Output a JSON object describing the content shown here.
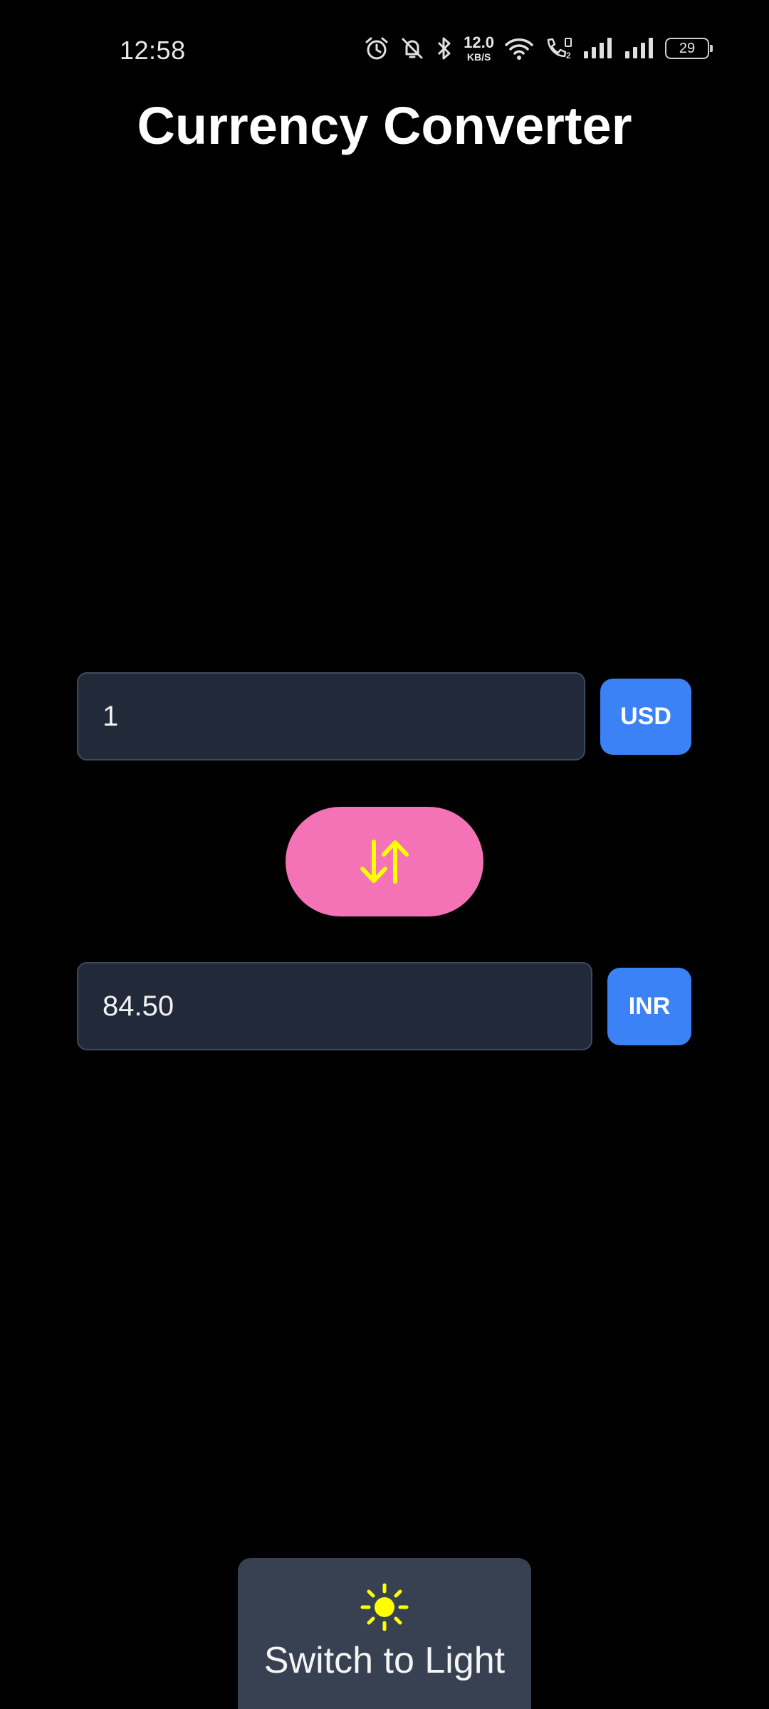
{
  "status_bar": {
    "time": "12:58",
    "net_speed_value": "12.0",
    "net_speed_unit": "KB/S",
    "battery": "29",
    "icons": [
      "alarm-icon",
      "bell-muted-icon",
      "bluetooth-icon",
      "wifi-icon",
      "volte-call-icon",
      "signal-1-icon",
      "signal-2-icon",
      "battery-icon"
    ]
  },
  "app": {
    "title": "Currency Converter"
  },
  "converter": {
    "from_amount": "1",
    "from_currency": "USD",
    "to_amount": "84.50",
    "to_currency": "INR",
    "swap_icon": "swap-vertical-icon"
  },
  "theme_toggle": {
    "icon": "sun-icon",
    "label": "Switch to Light"
  },
  "colors": {
    "background": "#000000",
    "input_bg": "#222a3a",
    "input_border": "#3e4a5e",
    "currency_button": "#3b82f6",
    "swap_button": "#f472b6",
    "swap_icon": "#ffff00",
    "theme_button": "#374151",
    "sun_icon": "#ffff00"
  }
}
